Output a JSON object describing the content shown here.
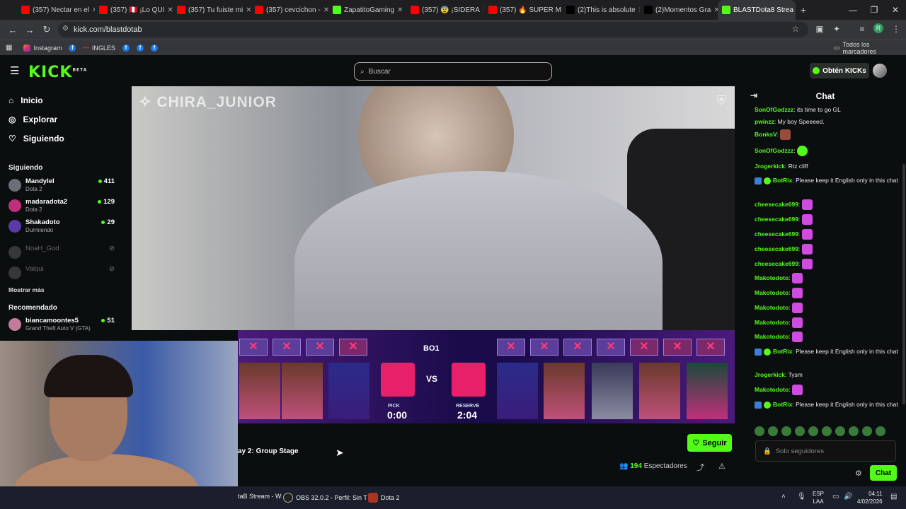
{
  "browser": {
    "tabs": [
      {
        "title": "(357) Nectar en el",
        "color": "#ff0000"
      },
      {
        "title": "(357) 🇵🇪 ¡Lo QUI",
        "color": "#ff0000"
      },
      {
        "title": "(357) Tu fuiste mi",
        "color": "#ff0000"
      },
      {
        "title": "(357) cevcichon -",
        "color": "#ff0000"
      },
      {
        "title": "ZapatitoGaming",
        "color": "#53fc18"
      },
      {
        "title": "(357) 😨 ¡SIDERA",
        "color": "#ff0000"
      },
      {
        "title": "(357) 🔥 SUPER M",
        "color": "#ff0000"
      },
      {
        "title": "(2)This is absolute",
        "color": "#000000"
      },
      {
        "title": "(2)Momentos Gra",
        "color": "#000000"
      },
      {
        "title": "BLASTDota8 Strea",
        "color": "#53fc18"
      }
    ],
    "new_tab": "+",
    "url": "kick.com/blastdotab",
    "bookmarks": [
      "Instagram",
      "INGLES"
    ],
    "all_bookmarks": "Todos los marcadores",
    "profile_initial": "R"
  },
  "header": {
    "logo": "KICK",
    "logo_badge": "BETA",
    "search_placeholder": "Buscar",
    "get_kicks": "Obtén KICKs"
  },
  "sidebar": {
    "nav": [
      {
        "label": "Inicio",
        "icon": "home-icon"
      },
      {
        "label": "Explorar",
        "icon": "compass-icon"
      },
      {
        "label": "Siguiendo",
        "icon": "heart-icon"
      }
    ],
    "following_title": "Siguiendo",
    "following": [
      {
        "name": "Mandylel",
        "game": "Dota 2",
        "viewers": "411",
        "live": true
      },
      {
        "name": "madaradota2",
        "game": "Dota 2",
        "viewers": "129",
        "live": true
      },
      {
        "name": "Shakadoto",
        "game": "Durmiendo",
        "viewers": "29",
        "live": true
      },
      {
        "name": "NoaH_God",
        "game": "",
        "viewers": "",
        "live": false
      },
      {
        "name": "Valqui",
        "game": "",
        "viewers": "",
        "live": false
      }
    ],
    "show_more": "Mostrar más",
    "recommended_title": "Recomendado",
    "recommended": [
      {
        "name": "biancamoontes5",
        "game": "Grand Theft Auto V (GTA)",
        "viewers": "51",
        "live": true
      }
    ]
  },
  "video": {
    "watermark": "CHIRA_JUNIOR",
    "draft": {
      "series": "BO1",
      "vs": "VS",
      "left_label": "PICK",
      "left_timer": "0:00",
      "right_label": "RESERVE",
      "right_timer": "2:04"
    }
  },
  "stream": {
    "title_fragment": "ay 2: Group Stage",
    "follow_label": "Seguir",
    "viewers": "194",
    "viewers_label": "Espectadores"
  },
  "chat": {
    "title": "Chat",
    "messages": [
      {
        "user": "SonOfGodzzz",
        "text": "its time to go GL",
        "color": "#53fc18"
      },
      {
        "user": "pwinzz",
        "text": "My boy Speeeed.",
        "color": "#53fc18"
      },
      {
        "user": "BonksV",
        "text": "",
        "emote": "box",
        "color": "#53fc18"
      },
      {
        "user": "SonOfGodzzz",
        "text": "",
        "emote": "green",
        "color": "#53fc18"
      },
      {
        "user": "Jrogerkick",
        "text": "Rtz cliff",
        "color": "#53fc18"
      },
      {
        "user": "BotRix",
        "text": "Please keep it English only in this chat",
        "color": "#53fc18",
        "badges": true
      },
      {
        "user": "cheesecake699",
        "text": "",
        "emote": "pink",
        "color": "#53fc18"
      },
      {
        "user": "cheesecake699",
        "text": "",
        "emote": "pink",
        "color": "#53fc18"
      },
      {
        "user": "cheesecake699",
        "text": "",
        "emote": "pink",
        "color": "#53fc18"
      },
      {
        "user": "cheesecake699",
        "text": "",
        "emote": "pink",
        "color": "#53fc18"
      },
      {
        "user": "cheesecake699",
        "text": "",
        "emote": "pink",
        "color": "#53fc18"
      },
      {
        "user": "Makotodoto",
        "text": "",
        "emote": "pink",
        "color": "#53fc18"
      },
      {
        "user": "Makotodoto",
        "text": "",
        "emote": "pink",
        "color": "#53fc18"
      },
      {
        "user": "Makotodoto",
        "text": "",
        "emote": "pink",
        "color": "#53fc18"
      },
      {
        "user": "Makotodoto",
        "text": "",
        "emote": "pink",
        "color": "#53fc18"
      },
      {
        "user": "Makotodoto",
        "text": "",
        "emote": "pink",
        "color": "#53fc18"
      },
      {
        "user": "BotRix",
        "text": "Please keep it English only in this chat",
        "color": "#53fc18",
        "badges": true
      },
      {
        "user": "Jrogerkick",
        "text": "Tysm",
        "color": "#53fc18"
      },
      {
        "user": "Makotodoto",
        "text": "",
        "emote": "pink",
        "color": "#53fc18"
      },
      {
        "user": "BotRix",
        "text": "Please keep it English only in this chat",
        "color": "#53fc18",
        "badges": true
      }
    ],
    "input_placeholder": "Solo seguidores",
    "send_label": "Chat"
  },
  "taskbar": {
    "items": [
      "taB Stream - W",
      "OBS 32.0.2 - Perfil: Sin T",
      "Dota 2"
    ],
    "lang_top": "ESP",
    "lang_bottom": "LAA",
    "time": "04:11",
    "date": "4/02/2026"
  },
  "colors": {
    "accent": "#53fc18",
    "background": "#0b0e0f"
  }
}
